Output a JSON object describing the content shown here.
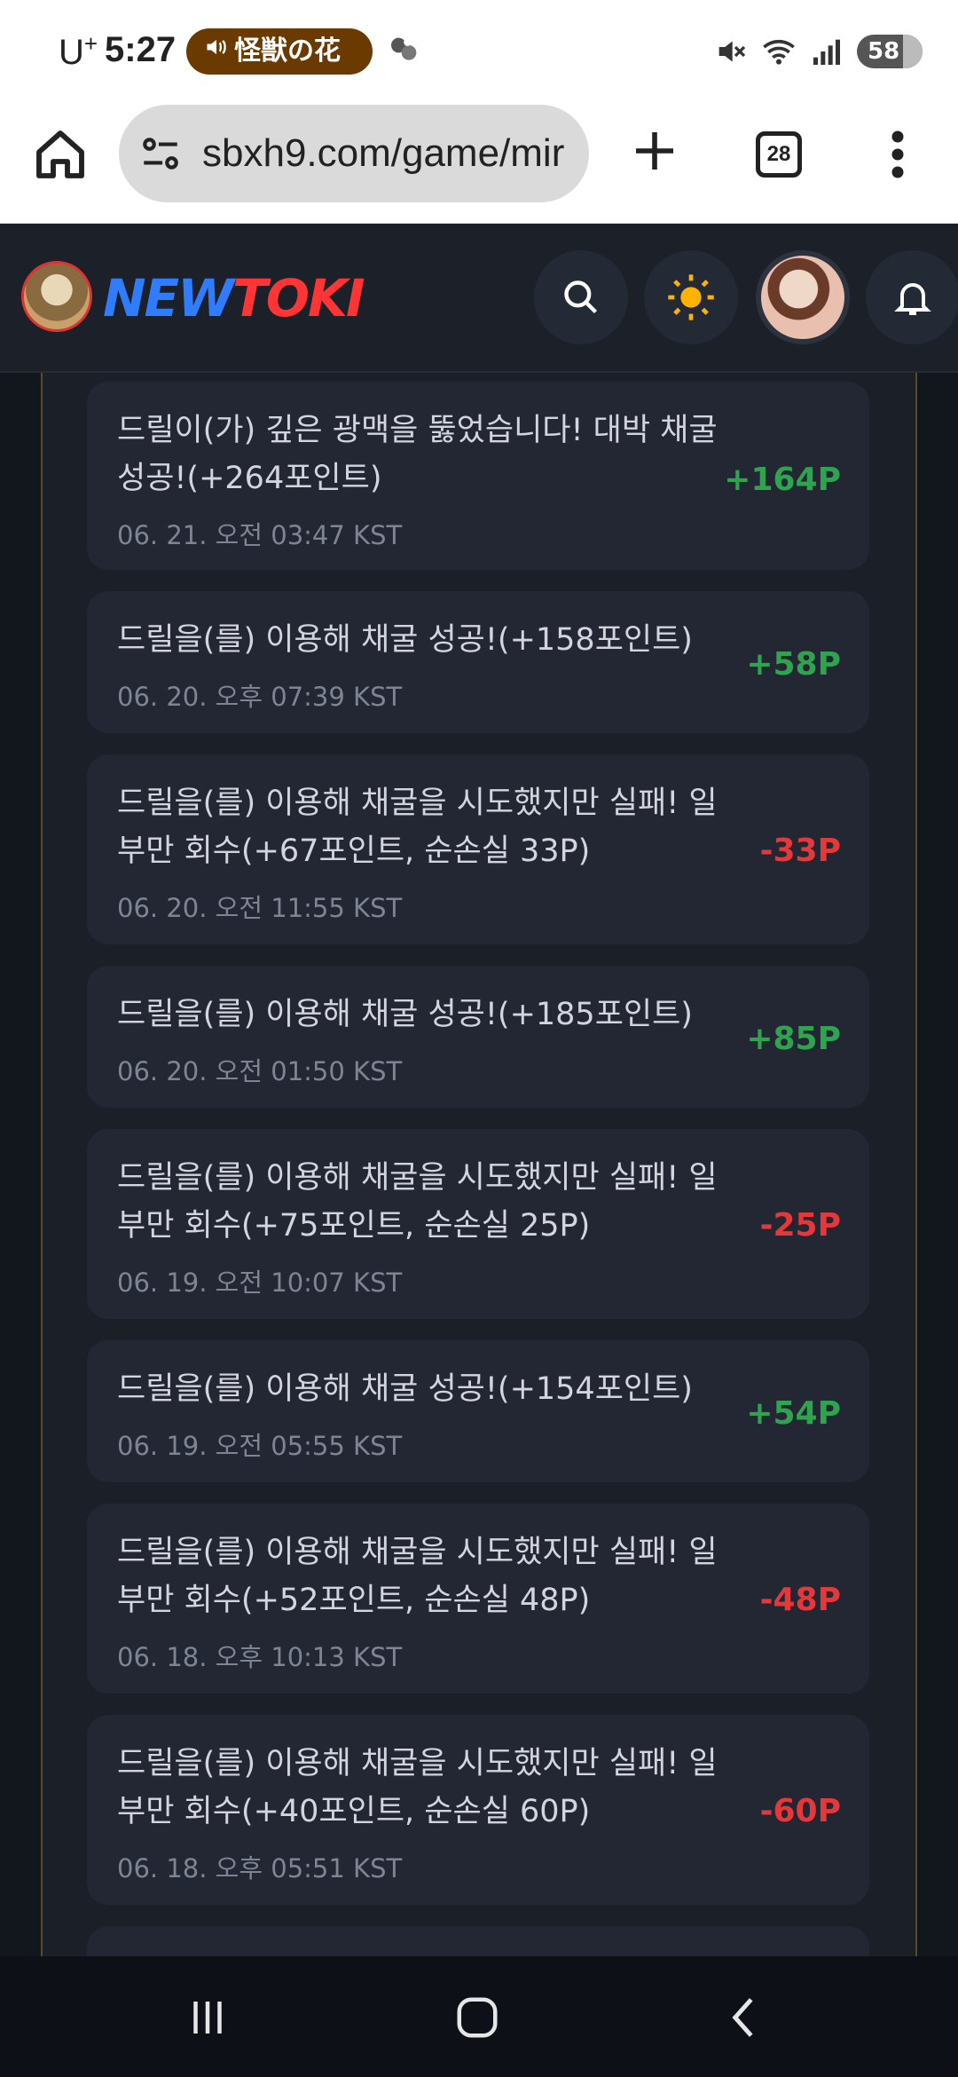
{
  "status_bar": {
    "carrier": "U",
    "carrier_sup": "+",
    "time": "5:27",
    "media_text": "怪獣の花",
    "battery": "58"
  },
  "browser": {
    "url": "sbxh9.com/game/mir",
    "tab_count": "28"
  },
  "site": {
    "logo_new": "NEW",
    "logo_toki": "TOKI"
  },
  "logs": [
    {
      "message": "드릴이(가) 깊은 광맥을 뚫었습니다! 대박 채굴 성공!(+264포인트)",
      "time": "06. 21. 오전 03:47 KST",
      "amount": "+164P",
      "type": "plus"
    },
    {
      "message": "드릴을(를) 이용해 채굴 성공!(+158포인트)",
      "time": "06. 20. 오후 07:39 KST",
      "amount": "+58P",
      "type": "plus"
    },
    {
      "message": "드릴을(를) 이용해 채굴을 시도했지만 실패! 일부만 회수(+67포인트, 순손실 33P)",
      "time": "06. 20. 오전 11:55 KST",
      "amount": "-33P",
      "type": "minus"
    },
    {
      "message": "드릴을(를) 이용해 채굴 성공!(+185포인트)",
      "time": "06. 20. 오전 01:50 KST",
      "amount": "+85P",
      "type": "plus"
    },
    {
      "message": "드릴을(를) 이용해 채굴을 시도했지만 실패! 일부만 회수(+75포인트, 순손실 25P)",
      "time": "06. 19. 오전 10:07 KST",
      "amount": "-25P",
      "type": "minus"
    },
    {
      "message": "드릴을(를) 이용해 채굴 성공!(+154포인트)",
      "time": "06. 19. 오전 05:55 KST",
      "amount": "+54P",
      "type": "plus"
    },
    {
      "message": "드릴을(를) 이용해 채굴을 시도했지만 실패! 일부만 회수(+52포인트, 순손실 48P)",
      "time": "06. 18. 오후 10:13 KST",
      "amount": "-48P",
      "type": "minus"
    },
    {
      "message": "드릴을(를) 이용해 채굴을 시도했지만 실패! 일부만 회수(+40포인트, 순손실 60P)",
      "time": "06. 18. 오후 05:51 KST",
      "amount": "-60P",
      "type": "minus"
    }
  ]
}
